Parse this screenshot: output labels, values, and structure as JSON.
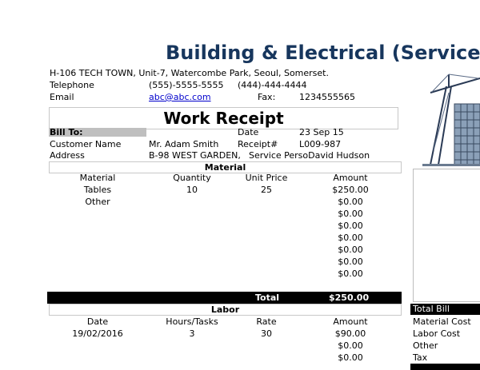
{
  "header": {
    "title": "Building & Electrical (Services",
    "address": "H-106 TECH TOWN, Unit-7, Watercombe Park, Seoul, Somerset.",
    "telephone_label": "Telephone",
    "telephone1": "(555)-5555-5555",
    "telephone2": "(444)-444-4444",
    "email_label": "Email",
    "email": "abc@abc.com",
    "fax_label": "Fax:",
    "fax": "1234555565"
  },
  "receipt": {
    "title": "Work Receipt",
    "bill_to_label": "Bill To:",
    "date_label": "Date",
    "date_value": "23 Sep 15",
    "customer_label": "Customer Name",
    "customer_value": "Mr. Adam Smith",
    "receipt_no_label": "Receipt#",
    "receipt_no_value": "L009-987",
    "address_label": "Address",
    "address_value": "B-98 WEST GARDEN,",
    "service_person": "Service PersoDavid Hudson"
  },
  "material": {
    "section_title": "Material",
    "headers": [
      "Material",
      "Quantity",
      "Unit Price",
      "Amount"
    ],
    "rows": [
      [
        "Tables",
        "10",
        "25",
        "$250.00"
      ],
      [
        "Other",
        "",
        "",
        "$0.00"
      ],
      [
        "",
        "",
        "",
        "$0.00"
      ],
      [
        "",
        "",
        "",
        "$0.00"
      ],
      [
        "",
        "",
        "",
        "$0.00"
      ],
      [
        "",
        "",
        "",
        "$0.00"
      ],
      [
        "",
        "",
        "",
        "$0.00"
      ],
      [
        "",
        "",
        "",
        "$0.00"
      ]
    ],
    "total_label": "Total",
    "total_value": "$250.00"
  },
  "labor": {
    "section_title": "Labor",
    "headers": [
      "Date",
      "Hours/Tasks",
      "Rate",
      "Amount"
    ],
    "rows": [
      [
        "19/02/2016",
        "3",
        "30",
        "$90.00"
      ],
      [
        "",
        "",
        "",
        "$0.00"
      ],
      [
        "",
        "",
        "",
        "$0.00"
      ]
    ]
  },
  "summary": {
    "total_bill_label": "Total Bill",
    "items": [
      "Material Cost",
      "Labor Cost",
      "Other",
      "Tax"
    ]
  },
  "colors": {
    "title": "#17365d",
    "bar": "#000000",
    "billto_fill": "#bfbfbf",
    "link": "#0000cc"
  }
}
